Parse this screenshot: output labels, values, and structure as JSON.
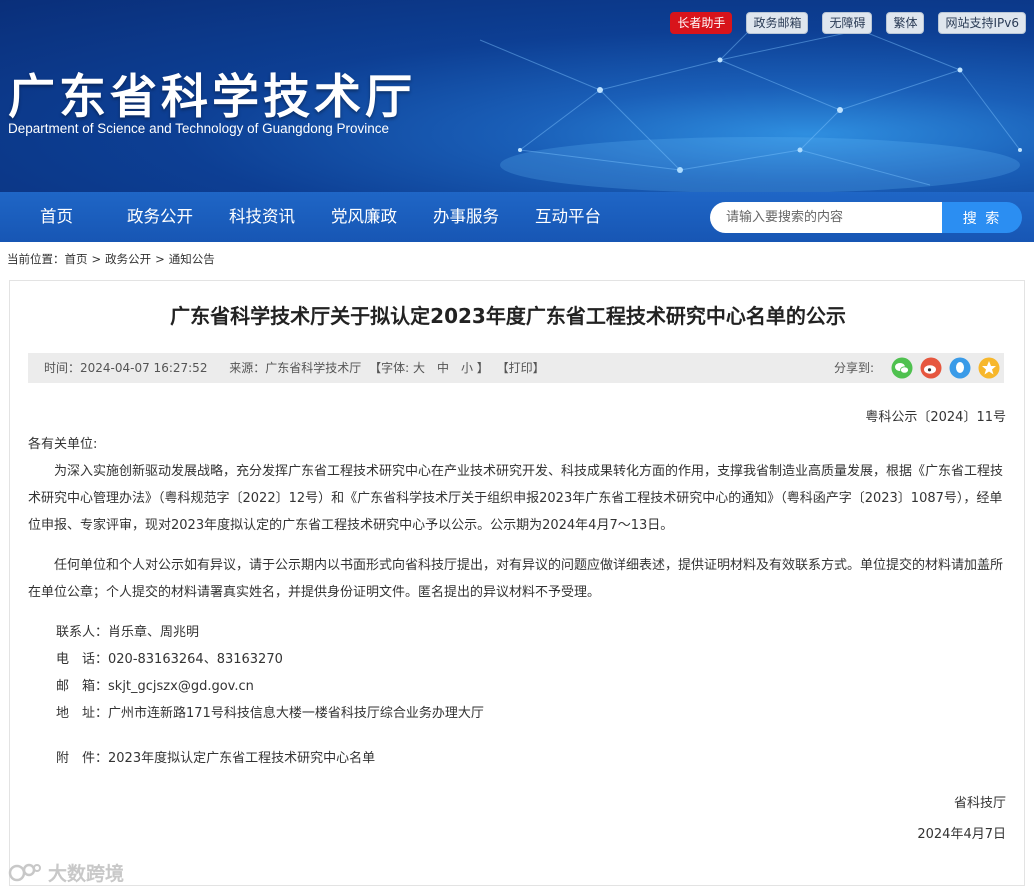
{
  "header": {
    "title": "广东省科学技术厅",
    "subtitle": "Department of Science and Technology of Guangdong Province",
    "top_links": [
      "长者助手",
      "政务邮箱",
      "无障碍",
      "繁体",
      "网站支持IPv6"
    ]
  },
  "nav": {
    "items": [
      "首页",
      "政务公开",
      "科技资讯",
      "党风廉政",
      "办事服务",
      "互动平台"
    ],
    "search_placeholder": "请输入要搜索的内容",
    "search_button": "搜 索"
  },
  "breadcrumb": {
    "prefix": "当前位置：",
    "items": [
      "首页",
      "政务公开",
      "通知公告"
    ],
    "separator": ">"
  },
  "article": {
    "title": "广东省科学技术厅关于拟认定2023年度广东省工程技术研究中心名单的公示",
    "time": "时间：2024-04-07 16:27:52",
    "source": "来源：广东省科学技术厅",
    "font_size": "【字体: 大　中　小 】",
    "print": "【打印】",
    "share_label": "分享到:",
    "share_icons": [
      "wechat-icon",
      "weibo-icon",
      "qq-icon",
      "qzone-icon"
    ],
    "doc_number": "粤科公示〔2024〕11号",
    "salutation": "各有关单位:",
    "paragraph1": "为深入实施创新驱动发展战略，充分发挥广东省工程技术研究中心在产业技术研究开发、科技成果转化方面的作用，支撑我省制造业高质量发展，根据《广东省工程技术研究中心管理办法》（粤科规范字〔2022〕12号）和《广东省科学技术厅关于组织申报2023年广东省工程技术研究中心的通知》（粤科函产字〔2023〕1087号），经单位申报、专家评审，现对2023年度拟认定的广东省工程技术研究中心予以公示。公示期为2024年4月7～13日。",
    "paragraph2": "任何单位和个人对公示如有异议，请于公示期内以书面形式向省科技厅提出，对有异议的问题应做详细表述，提供证明材料及有效联系方式。单位提交的材料请加盖所在单位公章；个人提交的材料请署真实姓名，并提供身份证明文件。匿名提出的异议材料不予受理。",
    "contacts": [
      {
        "label": "联系人：",
        "value": "肖乐章、周兆明"
      },
      {
        "label": "电　话：",
        "value": "020-83163264、83163270"
      },
      {
        "label": "邮　箱：",
        "value": "skjt_gcjszx@gd.gov.cn"
      },
      {
        "label": "地　址：",
        "value": "广州市连新路171号科技信息大楼一楼省科技厅综合业务办理大厅"
      }
    ],
    "attachment_label": "附　件：",
    "attachment": "2023年度拟认定广东省工程技术研究中心名单",
    "signature": "省科技厅",
    "date": "2024年4月7日"
  },
  "watermark": "大数跨境",
  "colors": {
    "nav_blue": "#1f66c6",
    "search_button": "#2b8ef2",
    "elder_red": "#d8141b"
  }
}
